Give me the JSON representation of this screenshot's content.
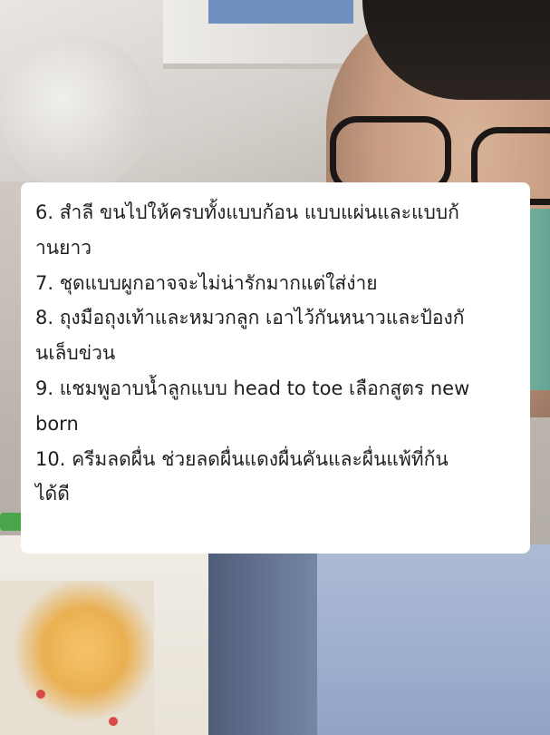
{
  "card": {
    "lines": [
      "6. สำลี ขนไปให้ครบทั้งแบบก้อน แบบแผ่นและแบบก้",
      "านยาว",
      "7. ชุดแบบผูกอาจจะไม่น่ารักมากแต่ใส่ง่าย",
      "8. ถุงมือถุงเท้าและหมวกลูก เอาไว้กันหนาวและป้องกั",
      "นเล็บข่วน",
      "9. แชมพูอาบน้ำลูกแบบ head to toe เลือกสูตร new",
      " born",
      "10. ครีมลดผื่น ช่วยลดผื่นแดงผื่นคันและผื่นแพ้ที่ก้น",
      "ได้ดี"
    ]
  }
}
